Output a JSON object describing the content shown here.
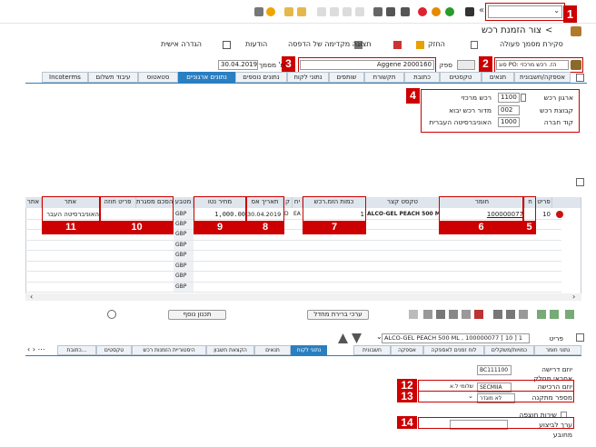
{
  "window": {
    "title": "צור הזמנת רכש"
  },
  "menu": {
    "items": [
      "סקירת מסמך פעולה",
      "החזק",
      "תצוגה מקדימה של הדפסה",
      "הודעות",
      "הגדרה אישית"
    ]
  },
  "header": {
    "doc_type": "סוג PO: הז. רכש מרכזי",
    "vendor_label": "ספק",
    "vendor_value": "Aggene 2000160",
    "date_label": "ת' מסמך",
    "date_value": "30.04.2019"
  },
  "header_tabs": [
    "אספקה/חשבונית",
    "תנאים",
    "טקסטים",
    "כתובת",
    "תקשורת",
    "שותפים",
    "נתוני לקוח",
    "נתונים נוספים",
    "נתונים ארגוניים",
    "סטאטוס",
    "עיבוד תשלום",
    "Incoterms"
  ],
  "org": {
    "purch_org_label": "ארגון רכש",
    "purch_org_value": "1100",
    "purch_org_desc": "רכש מרכזי",
    "purch_group_label": "קבוצת רכש",
    "purch_group_value": "002",
    "purch_group_desc": "מדור רכש יבוא",
    "company_label": "קוד חברה",
    "company_value": "1000",
    "company_desc": "האוניברסיטה העברית"
  },
  "items_table": {
    "columns": [
      "פריט",
      "ח",
      "חומר",
      "טקסט קצר",
      "כמות הזמ.רכש",
      "יח",
      "ק",
      "תאריך אס",
      "מחיר נטו",
      "מטבע",
      "הסכם מסגרת",
      "פריט חוזה",
      "אתר",
      "אתר"
    ],
    "row": {
      "item": "10",
      "material": "100000077",
      "short_text": "ALCO-GEL PEACH 500 ML",
      "qty": "1",
      "unit": "EA",
      "delivery_date": "30.04.2019",
      "net_price": "1,000.00",
      "site": "האוניברסיטה העבר"
    },
    "currency": "GBP",
    "empty_rows": 8
  },
  "table_buttons": {
    "more_planning": "תכנון נוסף",
    "default_values": "ערכי ברירת מחדל"
  },
  "item_detail": {
    "label": "פריט",
    "selector": "ALCO-GEL PEACH 500 ML , 100000077 [ 10 ] 1"
  },
  "item_tabs": [
    "נתוני חומר",
    "כמויות/משקלים",
    "לוח זמנים לאספקה",
    "אספקה",
    "חשבונית",
    "תנאים",
    "הקצאת חשבון",
    "היסטוריית הזמנות רכש",
    "טקסטים",
    "כתובת..."
  ],
  "item_active_tab_label": "נתוני לקוח",
  "detail": {
    "requester_label": "יוזם דרישה",
    "requester_value": "BC111100",
    "tracking_label": "אחראי מחלק",
    "buyer_label": "יוזם הרכישה",
    "buyer_value": "SECMIIA",
    "buyer_desc": "שלומי ל.א",
    "cat_label": "מספר מתקנה",
    "cat_value": "לא מוגדר",
    "extra_service_label": "שירות חוצפה",
    "cost_label": "ערך לביצוע",
    "contract_label": "מחובע"
  },
  "annotations": [
    "1",
    "2",
    "3",
    "4",
    "5",
    "6",
    "7",
    "8",
    "9",
    "10",
    "11",
    "12",
    "13",
    "14"
  ],
  "colors": {
    "red": "#cc0000",
    "tab_active": "#2a7fc1",
    "header_bg": "#dfe5ec"
  }
}
